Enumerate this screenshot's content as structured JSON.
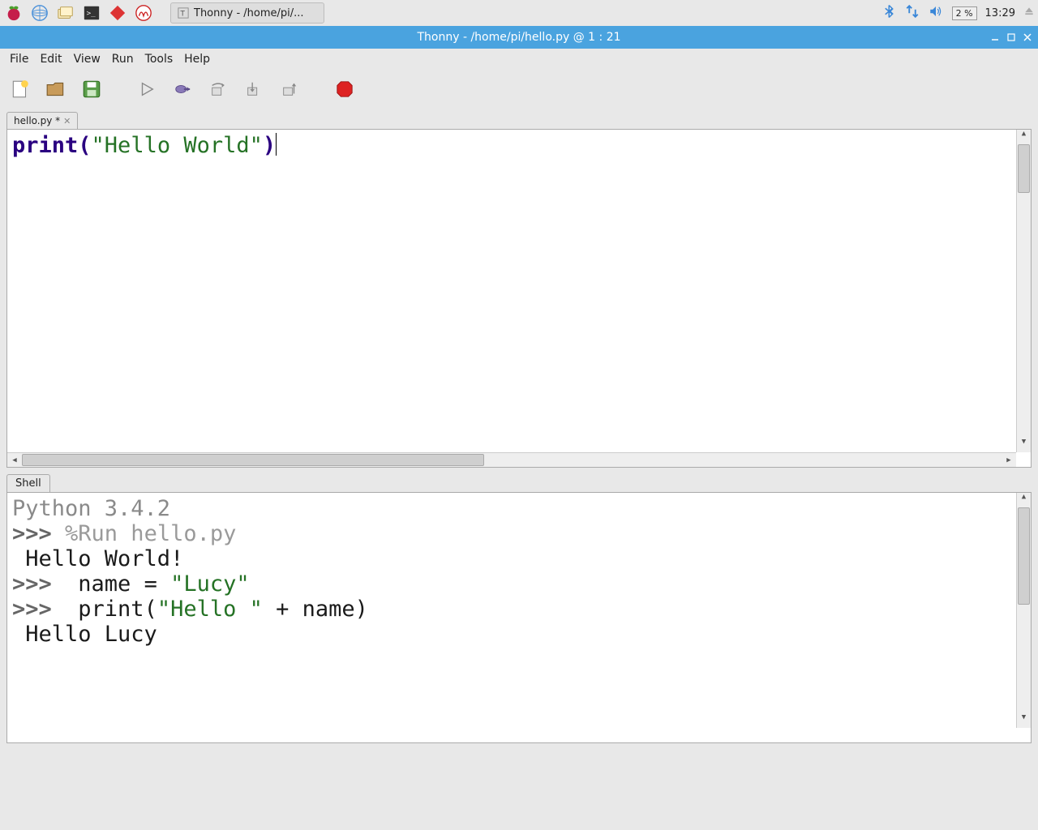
{
  "taskbar": {
    "app_title": "Thonny  -  /home/pi/...",
    "cpu": "2 %",
    "clock": "13:29"
  },
  "window": {
    "title": "Thonny  -  /home/pi/hello.py  @  1 : 21"
  },
  "menubar": [
    "File",
    "Edit",
    "View",
    "Run",
    "Tools",
    "Help"
  ],
  "editor": {
    "tab_label": "hello.py *",
    "code": {
      "fn": "print",
      "lparen": "(",
      "string": "\"Hello World\"",
      "rparen": ")"
    }
  },
  "shell": {
    "tab_label": "Shell",
    "version": "Python 3.4.2",
    "prompt": ">>> ",
    "lines": {
      "run_cmd": "%Run hello.py",
      "out1": " Hello World!",
      "in2_pre": " name = ",
      "in2_str": "\"Lucy\"",
      "in3_pre": " print(",
      "in3_str": "\"Hello \"",
      "in3_post": " + name)",
      "out2": " Hello Lucy"
    }
  }
}
